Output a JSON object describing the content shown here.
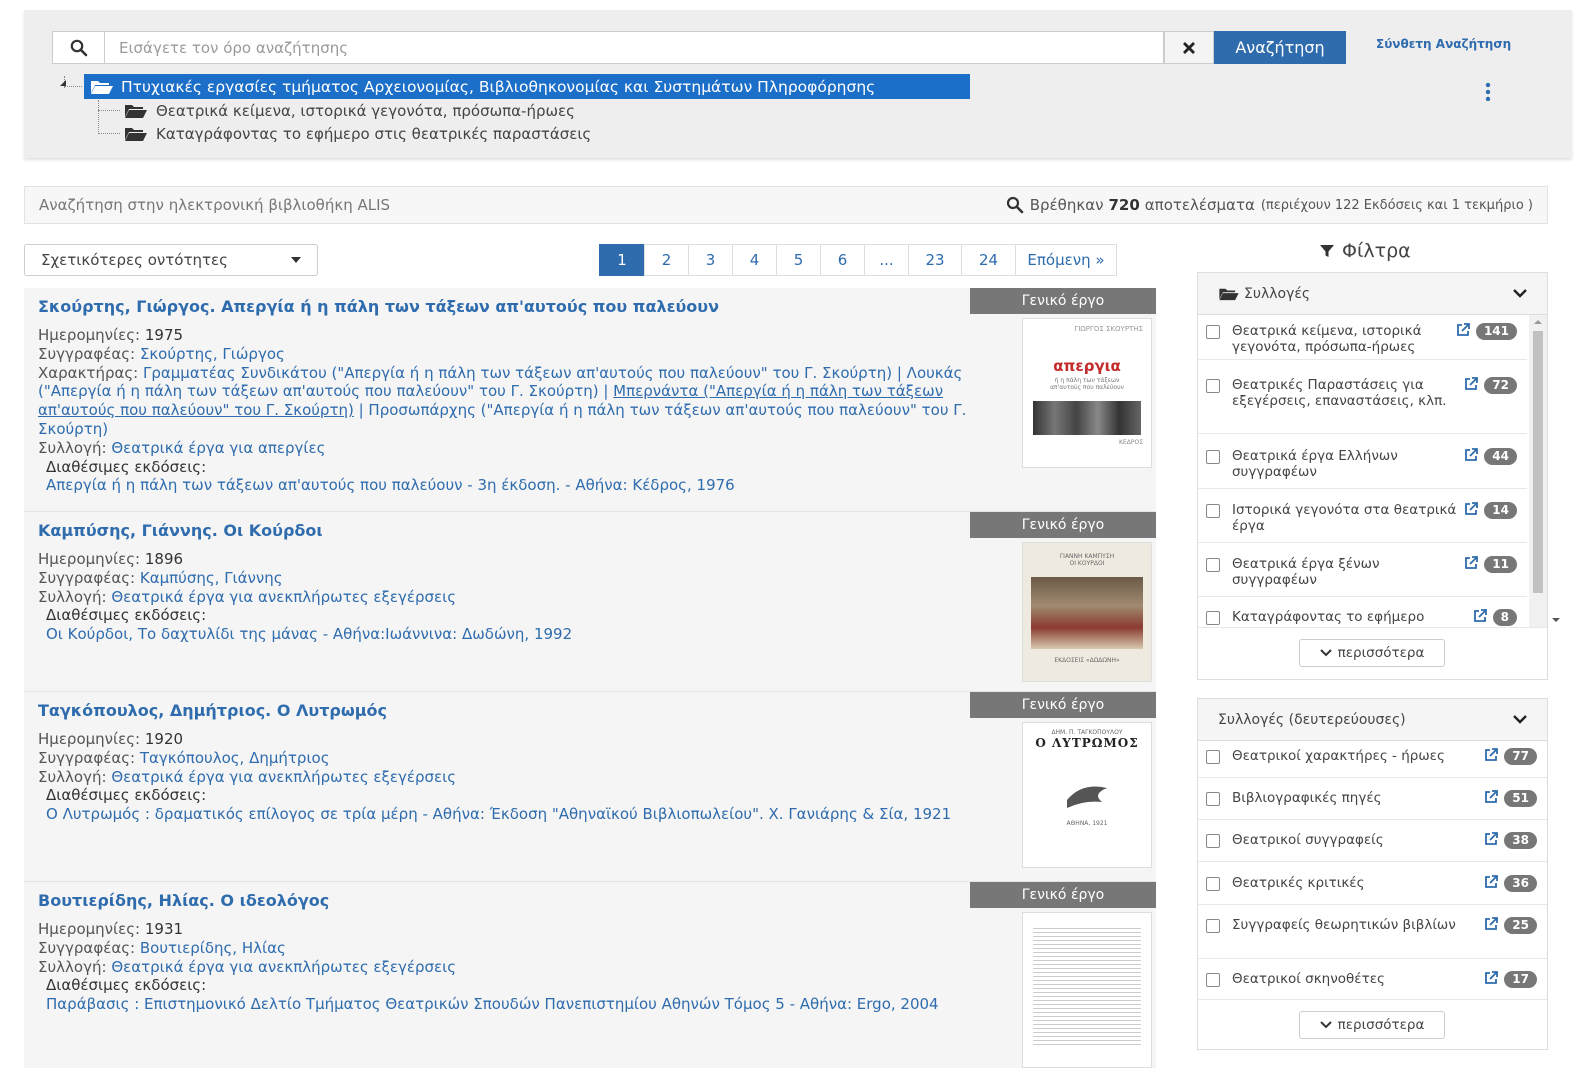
{
  "search": {
    "placeholder": "Εισάγετε τον όρο αναζήτησης",
    "button_label": "Αναζήτηση",
    "advanced_link": "Σύνθετη Αναζήτηση"
  },
  "tree": {
    "root": "Πτυχιακές εργασίες τμήματος Αρχειονομίας, Βιβλιοθηκονομίας και Συστημάτων Πληροφόρησης",
    "children": [
      "Θεατρικά κείμενα, ιστορικά γεγονότα, πρόσωπα-ήρωες",
      "Καταγράφοντας το εφήμερο στις θεατρικές παραστάσεις"
    ]
  },
  "info": {
    "scope": "Αναζήτηση στην ηλεκτρονική βιβλιοθήκη ALIS",
    "found_prefix": "Βρέθηκαν",
    "found_count": "720",
    "found_suffix": "αποτελέσματα",
    "found_detail": "(περιέχουν 122 Εκδόσεις και 1 τεκμήριο )"
  },
  "sort": {
    "selected": "Σχετικότερες οντότητες"
  },
  "pagination": [
    "1",
    "2",
    "3",
    "4",
    "5",
    "6",
    "...",
    "23",
    "24",
    "Επόμενη »"
  ],
  "labels": {
    "dates": "Ημερομηνίες:",
    "author": "Συγγραφέας:",
    "characters": "Χαρακτήρας:",
    "collection": "Συλλογή:",
    "editions": "Διαθέσιμες εκδόσεις:",
    "badge": "Γενικό έργο"
  },
  "results": [
    {
      "title": "Σκούρτης, Γιώργος. Απεργία ή η πάλη των τάξεων απ'αυτούς που παλεύουν",
      "date": "1975",
      "author": "Σκούρτης, Γιώργος",
      "characters_a": "Γραμματέας Συνδικάτου (\"Απεργία ή η πάλη των τάξεων απ'αυτούς που παλεύουν\" του Γ. Σκούρτη) | Λουκάς (\"Απεργία ή η πάλη των τάξεων απ'αυτούς που παλεύουν\" του Γ. Σκούρτη) | ",
      "characters_u": "Μπερνάντα (\"Απεργία ή η πάλη των τάξεων απ'αυτούς που παλεύουν\" του Γ. Σκούρτη)",
      "characters_b": " | Προσωπάρχης (\"Απεργία ή η πάλη των τάξεων απ'αυτούς που παλεύουν\" του Γ. Σκούρτη)",
      "collection": "Θεατρικά έργα για απεργίες",
      "edition": "Απεργία ή η πάλη των τάξεων απ'αυτούς που παλεύουν - 3η έκδοση. - Αθήνα: Κέδρος, 1976",
      "cover": {
        "top": "ΓΙΩΡΓΟΣ ΣΚΟΥΡΤΗΣ",
        "word": "απεργια",
        "sub": "ή η πάλη των τάξεων απ'αυτούς που παλεύουν",
        "foot": "ΚΕΔΡΟΣ"
      }
    },
    {
      "title": "Καμπύσης, Γιάννης. Οι Κούρδοι",
      "date": "1896",
      "author": "Καμπύσης, Γιάννης",
      "collection": "Θεατρικά έργα για ανεκπλήρωτες εξεγέρσεις",
      "edition": "Οι Κούρδοι, Το δαχτυλίδι της μάνας - Αθήνα:Ιωάννινα: Δωδώνη, 1992",
      "cover": {
        "top": "ΓΙΑΝΝΗ ΚΑΜΠΥΣΗ",
        "sub": "ΟΙ ΚΟΥΡΔΟΙ",
        "foot": "ΕΚΔΟΣΕΙΣ «ΔΩΔΩΝΗ»"
      }
    },
    {
      "title": "Ταγκόπουλος, Δημήτριος. Ο Λυτρωμός",
      "date": "1920",
      "author": "Ταγκόπουλος, Δημήτριος",
      "collection": "Θεατρικά έργα για ανεκπλήρωτες εξεγέρσεις",
      "edition": "Ο Λυτρωμός : δραματικός επίλογος σε τρία μέρη - Αθήνα: Έκδοση \"Αθηναϊκού Βιβλιοπωλείου\". Χ. Γανιάρης & Σία, 1921",
      "cover": {
        "top": "ΔΗΜ. Π. ΤΑΓΚΟΠΟΥΛΟΥ",
        "word": "Ο ΛΥΤΡΩΜΟΣ",
        "foot": "ΑΘΗΝΑ, 1921"
      }
    },
    {
      "title": "Βουτιερίδης, Ηλίας. Ο ιδεολόγος",
      "date": "1931",
      "author": "Βουτιερίδης, Ηλίας",
      "collection": "Θεατρικά έργα για ανεκπλήρωτες εξεγέρσεις",
      "edition": "Παράβασις : Επιστημονικό Δελτίο Τμήματος Θεατρικών Σπουδών Πανεπιστημίου Αθηνών Τόμος 5 - Αθήνα: Ergo, 2004"
    }
  ],
  "filters": {
    "title": "Φίλτρα",
    "more_label": "περισσότερα",
    "collections": {
      "title": "Συλλογές",
      "items": [
        {
          "label": "Θεατρικά κείμενα, ιστορικά γεγονότα, πρόσωπα-ήρωες",
          "count": "141"
        },
        {
          "label": "Θεατρικές Παραστάσεις για εξεγέρσεις, επαναστάσεις, κλπ.",
          "count": "72"
        },
        {
          "label": "Θεατρικά έργα Ελλήνων συγγραφέων",
          "count": "44"
        },
        {
          "label": "Ιστορικά γεγονότα στα θεατρικά έργα",
          "count": "14"
        },
        {
          "label": "Θεατρικά έργα ξένων συγγραφέων",
          "count": "11"
        },
        {
          "label": "Καταγράφοντας το εφήμερο",
          "count": "8"
        }
      ]
    },
    "secondary": {
      "title": "Συλλογές (δευτερεύουσες)",
      "items": [
        {
          "label": "Θεατρικοί χαρακτήρες - ήρωες",
          "count": "77"
        },
        {
          "label": "Βιβλιογραφικές πηγές",
          "count": "51"
        },
        {
          "label": "Θεατρικοί συγγραφείς",
          "count": "38"
        },
        {
          "label": "Θεατρικές κριτικές",
          "count": "36"
        },
        {
          "label": "Συγγραφείς θεωρητικών βιβλίων",
          "count": "25"
        },
        {
          "label": "Θεατρικοί σκηνοθέτες",
          "count": "17"
        }
      ]
    }
  },
  "colors": {
    "accent": "#2f6cae",
    "tree_highlight": "#1c6fc9",
    "badge": "#777777"
  }
}
